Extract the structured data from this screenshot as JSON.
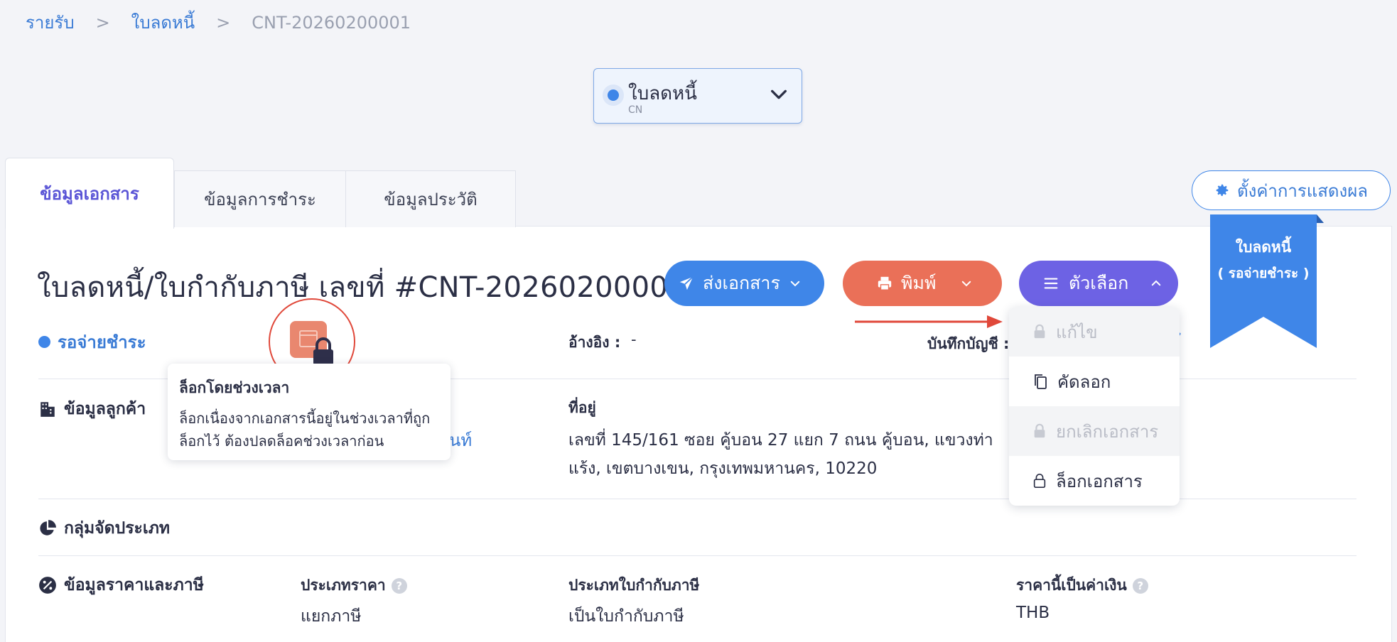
{
  "breadcrumb": {
    "items": [
      "รายรับ",
      "ใบลดหนี้"
    ],
    "separator": ">",
    "current": "CNT-20260200001"
  },
  "doc_type": {
    "title": "ใบลดหนี้",
    "code": "CN"
  },
  "tabs": [
    "ข้อมูลเอกสาร",
    "ข้อมูลการชำระ",
    "ข้อมูลประวัติ"
  ],
  "settings_button": "ตั้งค่าการแสดงผล",
  "ribbon": {
    "line1": "ใบลดหนี้",
    "line2": "( รอจ่ายชำระ )"
  },
  "document": {
    "title": "ใบลดหนี้/ใบกำกับภาษี เลขที่ #CNT-20260200001",
    "status": "รอจ่ายชำระ"
  },
  "actions": {
    "send": "ส่งเอกสาร",
    "print": "พิมพ์",
    "options": "ตัวเลือก"
  },
  "reference": {
    "label": "อ้างอิง :",
    "value": "-"
  },
  "accounting": {
    "label": "บันทึกบัญชี :"
  },
  "tooltip": {
    "title": "ล็อกโดยช่วงเวลา",
    "line1": "ล็อกเนื่องจากเอกสารนี้อยู่ในช่วงเวลาที่ถูก",
    "line2": "ล็อกไว้ ต้องปลดล็อคช่วงเวลาก่อน"
  },
  "customer": {
    "heading": "ข้อมูลลูกค้า",
    "link_fragment": "นท์",
    "address_label": "ที่อยู่",
    "address_line1": "เลขที่ 145/161 ซอย คู้บอน 27 แยก 7 ถนน คู้บอน, แขวงท่า",
    "address_line2": "แร้ง, เขตบางเขน, กรุงเทพมหานคร, 10220"
  },
  "category": {
    "heading": "กลุ่มจัดประเภท"
  },
  "pricing": {
    "heading": "ข้อมูลราคาและภาษี",
    "price_type_label": "ประเภทราคา",
    "price_type_value": "แยกภาษี",
    "tax_invoice_label": "ประเภทใบกำกับภาษี",
    "tax_invoice_value": "เป็นใบกำกับภาษี",
    "currency_label": "ราคานี้เป็นค่าเงิน",
    "currency_value": "THB"
  },
  "options_menu": [
    {
      "label": "แก้ไข",
      "disabled": true
    },
    {
      "label": "คัดลอก",
      "disabled": false
    },
    {
      "label": "ยกเลิกเอกสาร",
      "disabled": true
    },
    {
      "label": "ล็อกเอกสาร",
      "disabled": false
    }
  ],
  "colors": {
    "primary": "#3f86e8",
    "print": "#ea7058",
    "options": "#6d62e4",
    "highlight": "#e0483a"
  }
}
